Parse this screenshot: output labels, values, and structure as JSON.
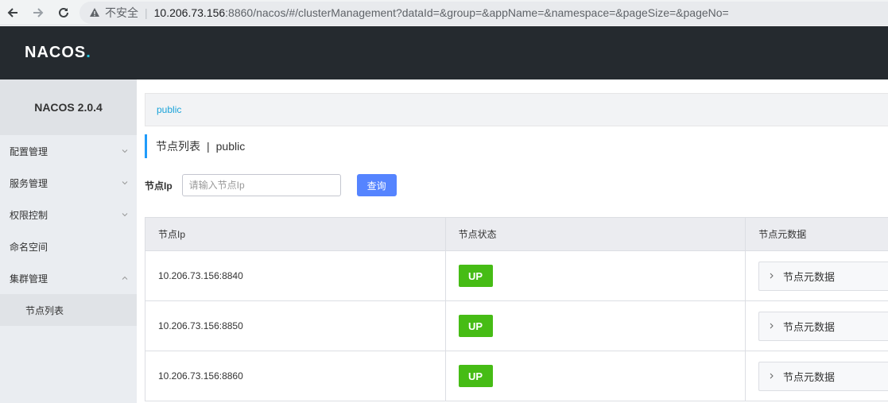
{
  "browser": {
    "insecure_label": "不安全",
    "url_host": "10.206.73.156",
    "url_path": ":8860/nacos/#/clusterManagement?dataId=&group=&appName=&namespace=&pageSize=&pageNo="
  },
  "header": {
    "logo_main": "NACOS",
    "logo_dot": "."
  },
  "sidebar": {
    "title": "NACOS 2.0.4",
    "items": [
      {
        "label": "配置管理",
        "expanded": false
      },
      {
        "label": "服务管理",
        "expanded": false
      },
      {
        "label": "权限控制",
        "expanded": false
      },
      {
        "label": "命名空间"
      },
      {
        "label": "集群管理",
        "expanded": true
      }
    ],
    "sub_items": [
      {
        "label": "节点列表"
      }
    ]
  },
  "main": {
    "breadcrumb": "public",
    "title": "节点列表",
    "title_sep": "|",
    "title_ns": "public",
    "search": {
      "label": "节点Ip",
      "placeholder": "请输入节点Ip",
      "button": "查询"
    },
    "table": {
      "columns": [
        "节点Ip",
        "节点状态",
        "节点元数据"
      ],
      "rows": [
        {
          "ip": "10.206.73.156:8840",
          "status": "UP",
          "meta": "节点元数据"
        },
        {
          "ip": "10.206.73.156:8850",
          "status": "UP",
          "meta": "节点元数据"
        },
        {
          "ip": "10.206.73.156:8860",
          "status": "UP",
          "meta": "节点元数据"
        }
      ]
    }
  },
  "colors": {
    "status_up": "#46bc15",
    "primary": "#5584ff",
    "header_bg": "#252a2f",
    "accent": "#209bfa"
  }
}
